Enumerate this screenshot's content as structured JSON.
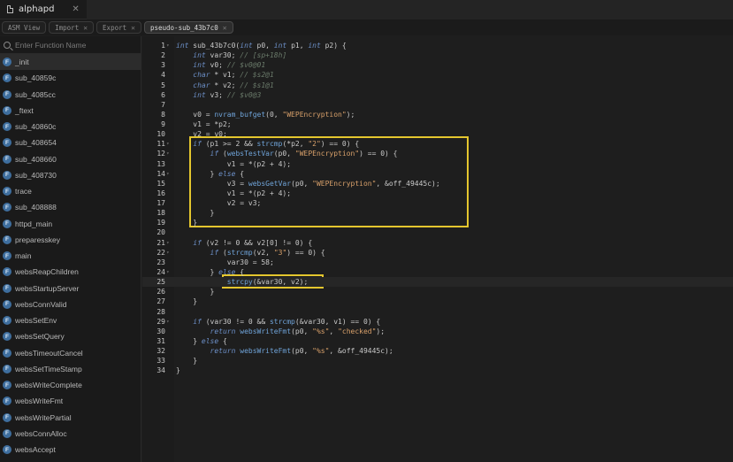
{
  "window": {
    "title": "alphapd",
    "close_glyph": "✕"
  },
  "view_tabs": [
    {
      "label": "ASM View",
      "closable": false,
      "active": false
    },
    {
      "label": "Import",
      "closable": true,
      "active": false
    },
    {
      "label": "Export",
      "closable": true,
      "active": false
    },
    {
      "label": "pseudo-sub_43b7c0",
      "closable": true,
      "active": true
    }
  ],
  "sidebar": {
    "search_placeholder": "Enter Function Name",
    "badge_letter": "F",
    "functions": [
      "_init",
      "sub_40859c",
      "sub_4085cc",
      "_ftext",
      "sub_40860c",
      "sub_408654",
      "sub_408660",
      "sub_408730",
      "trace",
      "sub_408888",
      "httpd_main",
      "preparesskey",
      "main",
      "websReapChildren",
      "websStartupServer",
      "websConnValid",
      "websSetEnv",
      "websSetQuery",
      "websTimeoutCancel",
      "websSetTimeStamp",
      "websWriteComplete",
      "websWriteFmt",
      "websWritePartial",
      "websConnAlloc",
      "websAccept"
    ],
    "selected_index": 0
  },
  "code": {
    "line_numbers": [
      "1",
      "2",
      "3",
      "4",
      "5",
      "6",
      "7",
      "8",
      "9",
      "10",
      "11",
      "12",
      "13",
      "14",
      "15",
      "16",
      "17",
      "18",
      "19",
      "20",
      "21",
      "22",
      "23",
      "24",
      "25",
      "26",
      "27",
      "28",
      "29",
      "30",
      "31",
      "32",
      "33",
      "34"
    ],
    "current_line_index": 24,
    "fold_lines": [
      0,
      10,
      11,
      13,
      20,
      21,
      23,
      28
    ],
    "lines": [
      [
        [
          "kw",
          "int"
        ],
        [
          "id",
          " sub_43b7c0("
        ],
        [
          "kw",
          "int"
        ],
        [
          "id",
          " p0, "
        ],
        [
          "kw",
          "int"
        ],
        [
          "id",
          " p1, "
        ],
        [
          "kw",
          "int"
        ],
        [
          "id",
          " p2) {"
        ]
      ],
      [
        [
          "id",
          "    "
        ],
        [
          "kw",
          "int"
        ],
        [
          "id",
          " var30; "
        ],
        [
          "cm",
          "// [sp+18h]"
        ]
      ],
      [
        [
          "id",
          "    "
        ],
        [
          "kw",
          "int"
        ],
        [
          "id",
          " v0; "
        ],
        [
          "cm",
          "// $v0@01"
        ]
      ],
      [
        [
          "id",
          "    "
        ],
        [
          "kw",
          "char"
        ],
        [
          "id",
          " * v1; "
        ],
        [
          "cm",
          "// $s2@1"
        ]
      ],
      [
        [
          "id",
          "    "
        ],
        [
          "kw",
          "char"
        ],
        [
          "id",
          " * v2; "
        ],
        [
          "cm",
          "// $s1@1"
        ]
      ],
      [
        [
          "id",
          "    "
        ],
        [
          "kw",
          "int"
        ],
        [
          "id",
          " v3; "
        ],
        [
          "cm",
          "// $v0@3"
        ]
      ],
      [],
      [
        [
          "id",
          "    v0 = "
        ],
        [
          "fn",
          "nvram_bufget"
        ],
        [
          "id",
          "(0, "
        ],
        [
          "str",
          "\"WEPEncryption\""
        ],
        [
          "id",
          ");"
        ]
      ],
      [
        [
          "id",
          "    v1 = *p2;"
        ]
      ],
      [
        [
          "id",
          "    v2 = v0;"
        ]
      ],
      [
        [
          "id",
          "    "
        ],
        [
          "kw",
          "if"
        ],
        [
          "id",
          " (p1 >= 2 && "
        ],
        [
          "fn",
          "strcmp"
        ],
        [
          "id",
          "(*p2, "
        ],
        [
          "str",
          "\"2\""
        ],
        [
          "id",
          ") == 0) {"
        ]
      ],
      [
        [
          "id",
          "        "
        ],
        [
          "kw",
          "if"
        ],
        [
          "id",
          " ("
        ],
        [
          "fn",
          "websTestVar"
        ],
        [
          "id",
          "(p0, "
        ],
        [
          "str",
          "\"WEPEncryption\""
        ],
        [
          "id",
          ") == 0) {"
        ]
      ],
      [
        [
          "id",
          "            v1 = *(p2 + 4);"
        ]
      ],
      [
        [
          "id",
          "        } "
        ],
        [
          "kw",
          "else"
        ],
        [
          "id",
          " {"
        ]
      ],
      [
        [
          "id",
          "            v3 = "
        ],
        [
          "fn",
          "websGetVar"
        ],
        [
          "id",
          "(p0, "
        ],
        [
          "str",
          "\"WEPEncryption\""
        ],
        [
          "id",
          ", &off_49445c);"
        ]
      ],
      [
        [
          "id",
          "            v1 = *(p2 + 4);"
        ]
      ],
      [
        [
          "id",
          "            v2 = v3;"
        ]
      ],
      [
        [
          "id",
          "        }"
        ]
      ],
      [
        [
          "id",
          "    }"
        ]
      ],
      [],
      [
        [
          "id",
          "    "
        ],
        [
          "kw",
          "if"
        ],
        [
          "id",
          " (v2 != 0 && v2[0] != 0) {"
        ]
      ],
      [
        [
          "id",
          "        "
        ],
        [
          "kw",
          "if"
        ],
        [
          "id",
          " ("
        ],
        [
          "fn",
          "strcmp"
        ],
        [
          "id",
          "(v2, "
        ],
        [
          "str",
          "\"3\""
        ],
        [
          "id",
          ") == 0) {"
        ]
      ],
      [
        [
          "id",
          "            var30 = 58;"
        ]
      ],
      [
        [
          "id",
          "        } "
        ],
        [
          "kw",
          "else"
        ],
        [
          "id",
          " {"
        ]
      ],
      [
        [
          "id",
          "            "
        ],
        [
          "fn",
          "strcpy"
        ],
        [
          "id",
          "(&var30, v2);"
        ]
      ],
      [
        [
          "id",
          "        }"
        ]
      ],
      [
        [
          "id",
          "    }"
        ]
      ],
      [],
      [
        [
          "id",
          "    "
        ],
        [
          "kw",
          "if"
        ],
        [
          "id",
          " (var30 != 0 && "
        ],
        [
          "fn",
          "strcmp"
        ],
        [
          "id",
          "(&var30, v1) == 0) {"
        ]
      ],
      [
        [
          "id",
          "        "
        ],
        [
          "kw",
          "return"
        ],
        [
          "id",
          " "
        ],
        [
          "fn",
          "websWriteFmt"
        ],
        [
          "id",
          "(p0, "
        ],
        [
          "str",
          "\"%s\""
        ],
        [
          "id",
          ", "
        ],
        [
          "str",
          "\"checked\""
        ],
        [
          "id",
          ");"
        ]
      ],
      [
        [
          "id",
          "    } "
        ],
        [
          "kw",
          "else"
        ],
        [
          "id",
          " {"
        ]
      ],
      [
        [
          "id",
          "        "
        ],
        [
          "kw",
          "return"
        ],
        [
          "id",
          " "
        ],
        [
          "fn",
          "websWriteFmt"
        ],
        [
          "id",
          "(p0, "
        ],
        [
          "str",
          "\"%s\""
        ],
        [
          "id",
          ", &off_49445c);"
        ]
      ],
      [
        [
          "id",
          "    }"
        ]
      ],
      [
        [
          "id",
          "}"
        ]
      ]
    ]
  },
  "colors": {
    "background": "#1e1e1e",
    "keyword": "#6c8fc7",
    "function": "#6fa3d8",
    "string": "#d8a06a",
    "comment": "#6a7a6a",
    "highlight_box": "#e4c62e",
    "function_badge": "#3e6e9e"
  }
}
